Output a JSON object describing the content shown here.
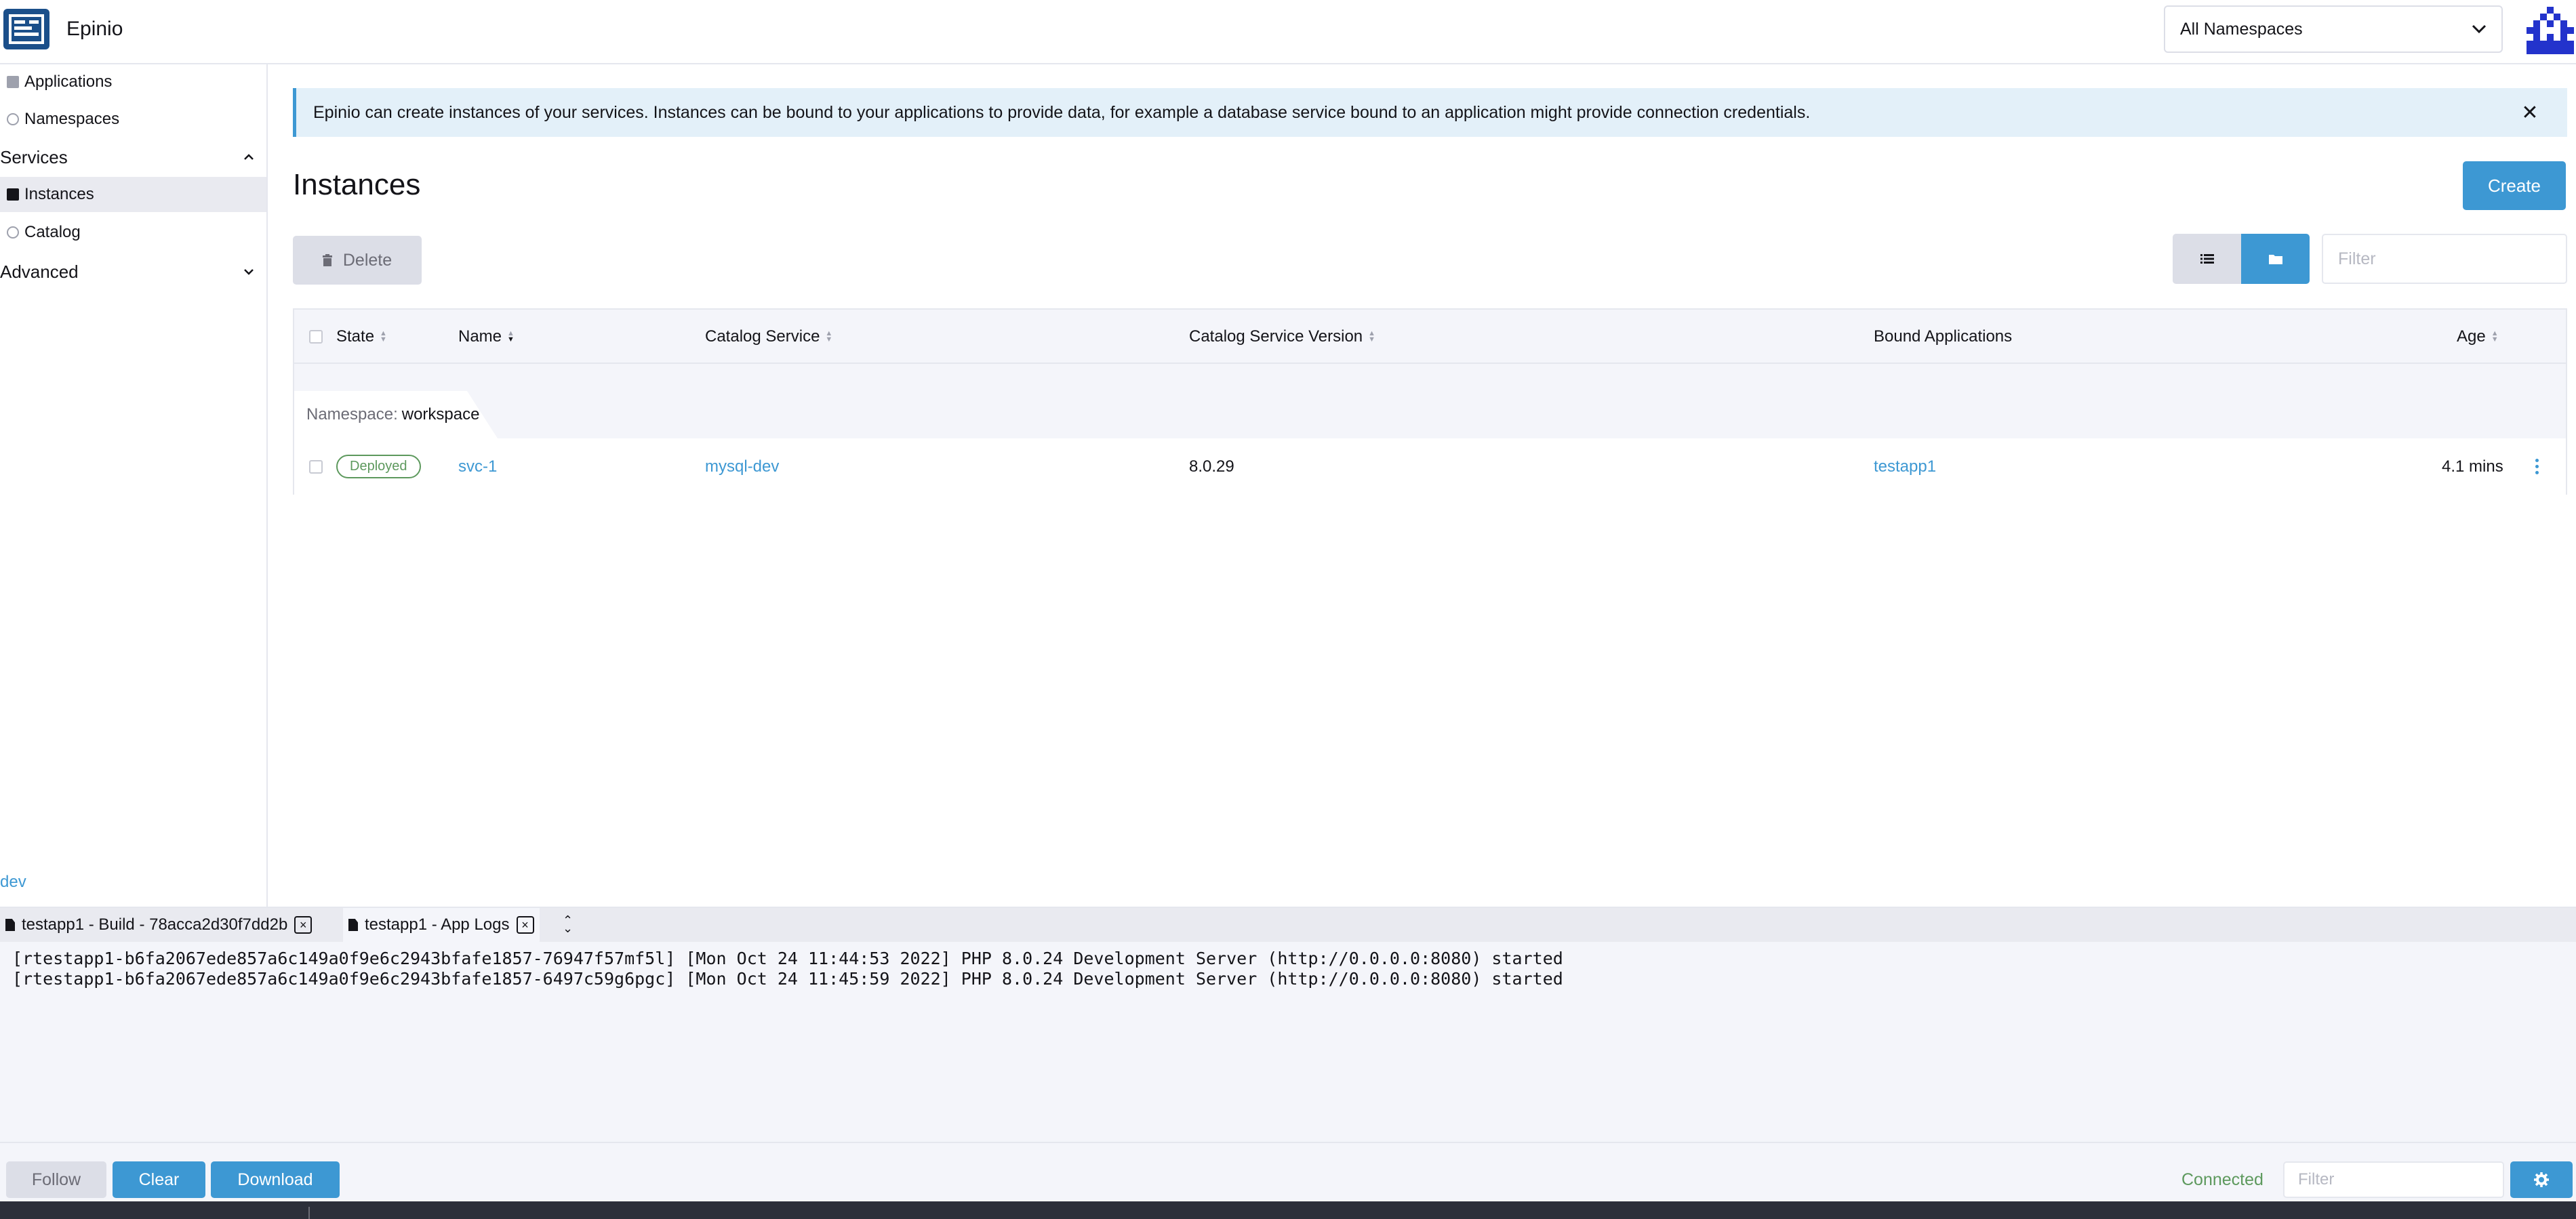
{
  "header": {
    "app_name": "Epinio",
    "namespace_select": "All Namespaces"
  },
  "sidebar": {
    "items": [
      {
        "label": "Applications",
        "icon": "folder-icon"
      },
      {
        "label": "Namespaces",
        "icon": "circle-icon"
      }
    ],
    "groups": {
      "services": "Services",
      "advanced": "Advanced"
    },
    "service_items": [
      {
        "label": "Instances",
        "icon": "folder-icon",
        "active": true
      },
      {
        "label": "Catalog",
        "icon": "circle-icon"
      }
    ],
    "footer_link": "dev"
  },
  "banner": {
    "text": "Epinio can create instances of your services. Instances can be bound to your applications to provide data, for example a database service bound to an application might provide connection credentials.",
    "close": "✕"
  },
  "page": {
    "title": "Instances",
    "create_label": "Create",
    "delete_label": "Delete",
    "filter_placeholder": "Filter"
  },
  "table": {
    "headers": {
      "state": "State",
      "name": "Name",
      "catalog_service": "Catalog Service",
      "catalog_service_version": "Catalog Service Version",
      "bound_applications": "Bound Applications",
      "age": "Age"
    },
    "group": {
      "key": "Namespace:",
      "value": "workspace"
    },
    "rows": [
      {
        "state": "Deployed",
        "name": "svc-1",
        "catalog_service": "mysql-dev",
        "version": "8.0.29",
        "bound_app": "testapp1",
        "age": "4.1 mins"
      }
    ]
  },
  "logs": {
    "tabs": [
      {
        "label": "testapp1 - Build - 78acca2d30f7dd2b"
      },
      {
        "label": "testapp1 - App Logs"
      }
    ],
    "lines": [
      "[rtestapp1-b6fa2067ede857a6c149a0f9e6c2943bfafe1857-76947f57mf5l] [Mon Oct 24 11:44:53 2022] PHP 8.0.24 Development Server (http://0.0.0.0:8080) started",
      "[rtestapp1-b6fa2067ede857a6c149a0f9e6c2943bfafe1857-6497c59g6pgc] [Mon Oct 24 11:45:59 2022] PHP 8.0.24 Development Server (http://0.0.0.0:8080) started"
    ],
    "footer": {
      "follow_label": "Follow",
      "clear_label": "Clear",
      "download_label": "Download",
      "status": "Connected",
      "filter_placeholder": "Filter"
    }
  },
  "colors": {
    "accent": "#3d98d3",
    "success": "#5d995d",
    "brand": "#1b4f8a",
    "avatar": "#2333cc"
  }
}
